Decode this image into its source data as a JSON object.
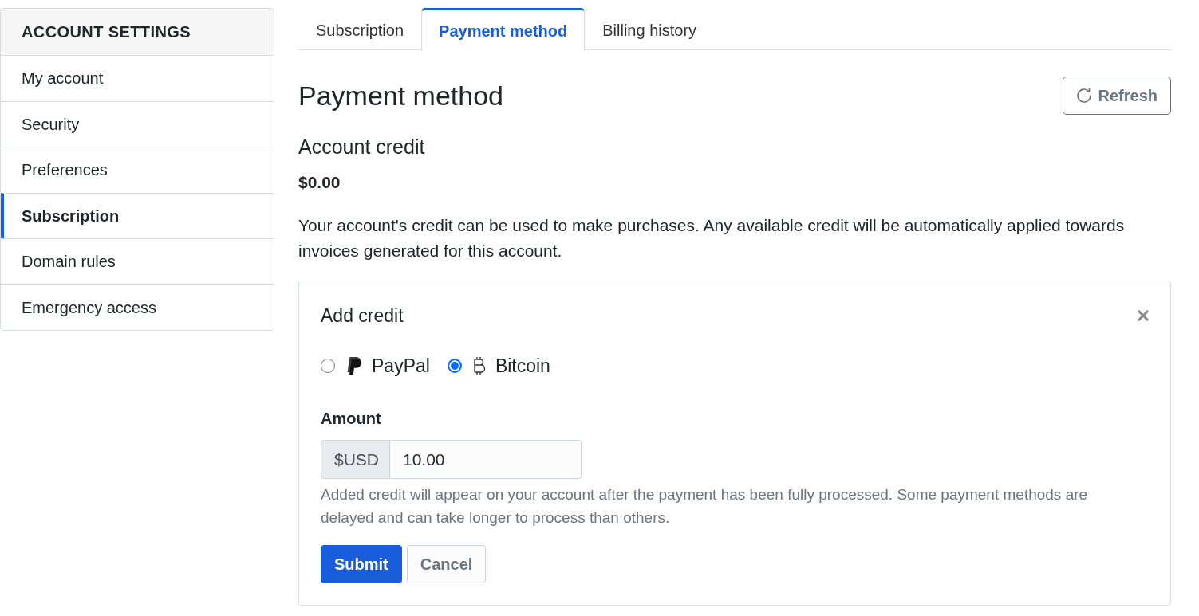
{
  "sidebar": {
    "title": "ACCOUNT SETTINGS",
    "items": [
      {
        "label": "My account",
        "selected": false
      },
      {
        "label": "Security",
        "selected": false
      },
      {
        "label": "Preferences",
        "selected": false
      },
      {
        "label": "Subscription",
        "selected": true
      },
      {
        "label": "Domain rules",
        "selected": false
      },
      {
        "label": "Emergency access",
        "selected": false
      }
    ]
  },
  "tabs": [
    {
      "label": "Subscription",
      "selected": false
    },
    {
      "label": "Payment method",
      "selected": true
    },
    {
      "label": "Billing history",
      "selected": false
    }
  ],
  "page": {
    "title": "Payment method",
    "refresh_button": "Refresh"
  },
  "account_credit": {
    "heading": "Account credit",
    "amount": "$0.00",
    "description": "Your account's credit can be used to make purchases. Any available credit will be automatically applied towards invoices generated for this account."
  },
  "add_credit": {
    "title": "Add credit",
    "methods": [
      {
        "label": "PayPal",
        "selected": false
      },
      {
        "label": "Bitcoin",
        "selected": true
      }
    ],
    "amount_label": "Amount",
    "currency": "$USD",
    "value": "10.00",
    "help": "Added credit will appear on your account after the payment has been fully processed. Some payment methods are delayed and can take longer to process than others.",
    "buttons": [
      {
        "label": "Submit",
        "kind": "primary"
      },
      {
        "label": "Cancel",
        "kind": "secondary"
      }
    ]
  }
}
